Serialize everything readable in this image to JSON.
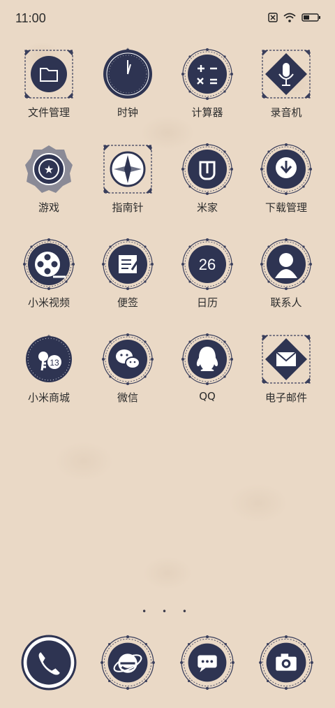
{
  "status": {
    "time": "11:00",
    "icons": [
      "sim-off-icon",
      "wifi-icon",
      "battery-icon"
    ]
  },
  "apps": [
    {
      "label": "文件管理",
      "icon": "folder-icon"
    },
    {
      "label": "时钟",
      "icon": "clock-icon"
    },
    {
      "label": "计算器",
      "icon": "calculator-icon"
    },
    {
      "label": "录音机",
      "icon": "microphone-icon"
    },
    {
      "label": "游戏",
      "icon": "star-shield-icon"
    },
    {
      "label": "指南针",
      "icon": "compass-icon"
    },
    {
      "label": "米家",
      "icon": "mijia-icon"
    },
    {
      "label": "下载管理",
      "icon": "download-icon"
    },
    {
      "label": "小米视频",
      "icon": "film-reel-icon"
    },
    {
      "label": "便签",
      "icon": "notepad-icon"
    },
    {
      "label": "日历",
      "icon": "calendar-icon",
      "badge": "26"
    },
    {
      "label": "联系人",
      "icon": "contact-icon"
    },
    {
      "label": "小米商城",
      "icon": "shopping-icon",
      "badge": "13"
    },
    {
      "label": "微信",
      "icon": "wechat-icon"
    },
    {
      "label": "QQ",
      "icon": "qq-icon"
    },
    {
      "label": "电子邮件",
      "icon": "email-icon"
    }
  ],
  "page_dots": "• • •",
  "dock": [
    {
      "icon": "phone-icon"
    },
    {
      "icon": "browser-icon"
    },
    {
      "icon": "messages-icon"
    },
    {
      "icon": "camera-icon"
    }
  ],
  "colors": {
    "icon_fill": "#2e3452",
    "ornament": "#3a3f5c",
    "background": "#ead9c6"
  }
}
